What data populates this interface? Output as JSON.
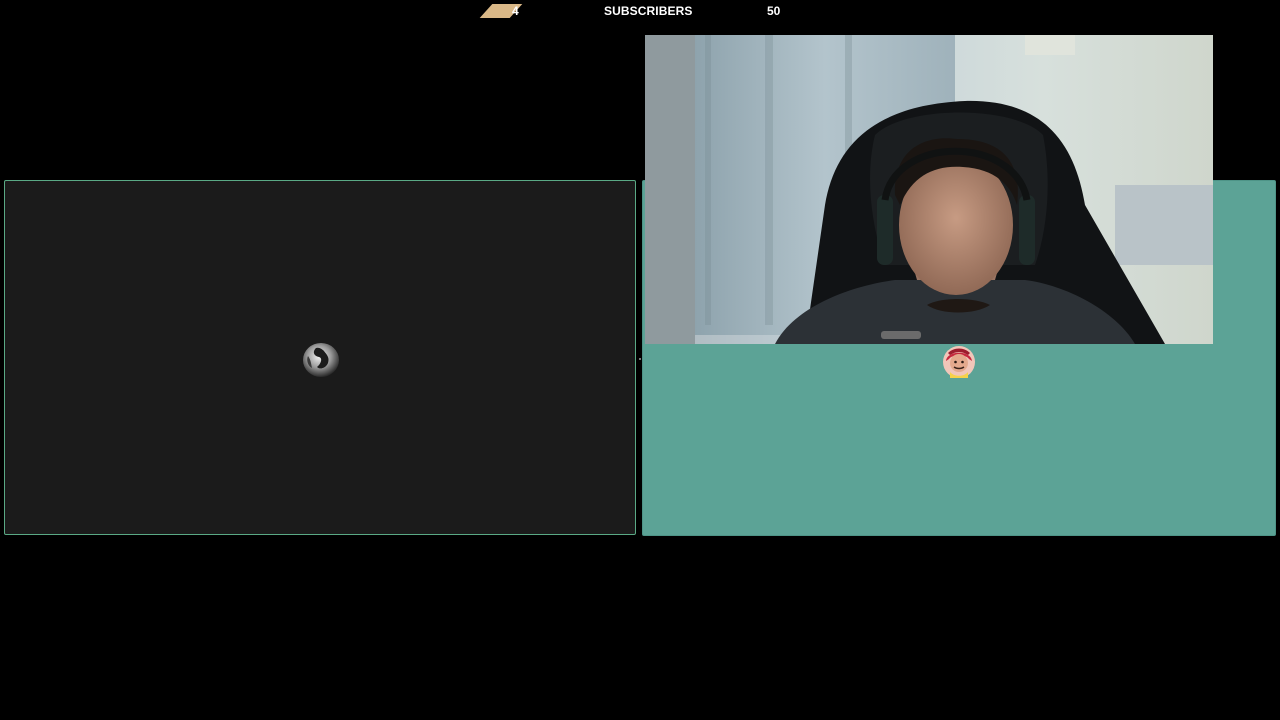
{
  "subscriber_bar": {
    "current": "4",
    "label": "SUBSCRIBERS",
    "goal": "50",
    "accent": "#d9b887"
  },
  "left_panel": {
    "icon": "loading-globe-icon",
    "background": "#1b1b1b",
    "border": "#5aa985"
  },
  "right_panel": {
    "background": "#5ca396"
  },
  "webcam": {
    "subject": "streamer-in-gaming-chair"
  },
  "avatar": {
    "icon": "cartoon-avatar-icon"
  }
}
